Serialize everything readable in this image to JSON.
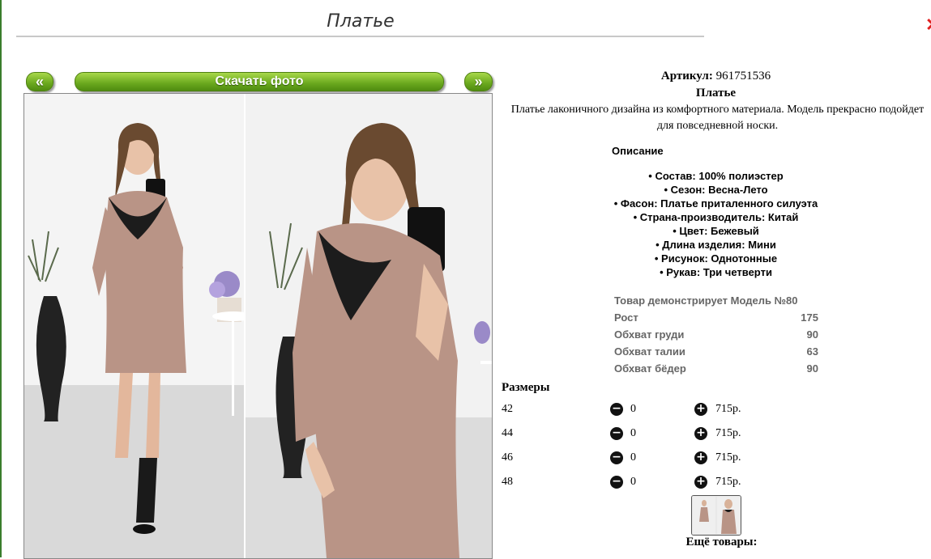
{
  "header": {
    "title": "Платье"
  },
  "nav": {
    "prev_label": "«",
    "download_label": "Скачать фото",
    "next_label": "»"
  },
  "product": {
    "article_label": "Артикул:",
    "article_value": "961751536",
    "name": "Платье",
    "description": "Платье лаконичного дизайна из комфортного материала. Модель прекрасно подойдет для повседневной носки."
  },
  "details": {
    "heading": "Описание",
    "specs": [
      "• Состав: 100% полиэстер",
      "• Сезон: Весна-Лето",
      "• Фасон: Платье приталенного силуэта",
      "• Страна-производитель: Китай",
      "• Цвет: Бежевый",
      "• Длина изделия: Мини",
      "• Рисунок: Однотонные",
      "• Рукав: Три четверти"
    ]
  },
  "model": {
    "rows": [
      {
        "k": "Товар демонстрирует Модель №80",
        "v": ""
      },
      {
        "k": "Рост",
        "v": "175"
      },
      {
        "k": "Обхват груди",
        "v": "90"
      },
      {
        "k": "Обхват талии",
        "v": "63"
      },
      {
        "k": "Обхват бёдер",
        "v": "90"
      }
    ]
  },
  "sizes": {
    "heading": "Размеры",
    "rows": [
      {
        "size": "42",
        "qty": "0",
        "price": "715р."
      },
      {
        "size": "44",
        "qty": "0",
        "price": "715р."
      },
      {
        "size": "46",
        "qty": "0",
        "price": "715р."
      },
      {
        "size": "48",
        "qty": "0",
        "price": "715р."
      }
    ]
  },
  "more": {
    "heading": "Ещё товары:"
  },
  "icons": {
    "minus": "minus-circle-icon",
    "plus": "plus-circle-icon"
  },
  "colors": {
    "button_green": "#6aa81e",
    "link_green": "#1a8a1a",
    "dress": "#b99486",
    "lace": "#1c1c1c"
  }
}
